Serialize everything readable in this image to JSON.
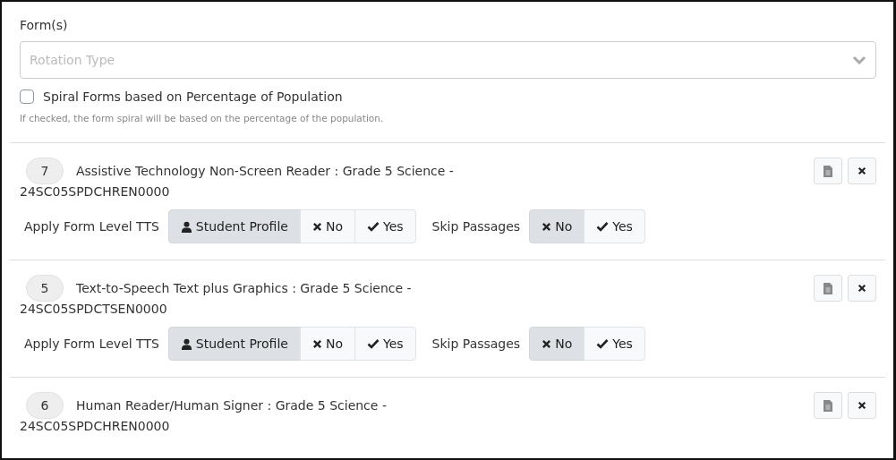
{
  "forms_label": "Form(s)",
  "rotation_select": {
    "placeholder": "Rotation Type"
  },
  "spiral_checkbox": {
    "label": "Spiral Forms based on Percentage of Population",
    "checked": false
  },
  "spiral_hint": "If checked, the form spiral will be based on the percentage of the population.",
  "forms": [
    {
      "count": "7",
      "title": "Assistive Technology Non-Screen Reader : Grade 5 Science -",
      "code": "24SC05SPDCHREN0000",
      "settings": [
        {
          "label": "Apply Form Level TTS",
          "options": [
            {
              "kind": "profile",
              "label": "Student Profile",
              "selected": true
            },
            {
              "kind": "no",
              "label": "No",
              "selected": false
            },
            {
              "kind": "yes",
              "label": "Yes",
              "selected": false
            }
          ]
        },
        {
          "label": "Skip Passages",
          "options": [
            {
              "kind": "no",
              "label": "No",
              "selected": true
            },
            {
              "kind": "yes",
              "label": "Yes",
              "selected": false
            }
          ]
        }
      ]
    },
    {
      "count": "5",
      "title": "Text-to-Speech Text plus Graphics : Grade 5 Science -",
      "code": "24SC05SPDCTSEN0000",
      "settings": [
        {
          "label": "Apply Form Level TTS",
          "options": [
            {
              "kind": "profile",
              "label": "Student Profile",
              "selected": true
            },
            {
              "kind": "no",
              "label": "No",
              "selected": false
            },
            {
              "kind": "yes",
              "label": "Yes",
              "selected": false
            }
          ]
        },
        {
          "label": "Skip Passages",
          "options": [
            {
              "kind": "no",
              "label": "No",
              "selected": true
            },
            {
              "kind": "yes",
              "label": "Yes",
              "selected": false
            }
          ]
        }
      ]
    },
    {
      "count": "6",
      "title": "Human Reader/Human Signer : Grade 5 Science -",
      "code": "24SC05SPDCHREN0000"
    }
  ]
}
